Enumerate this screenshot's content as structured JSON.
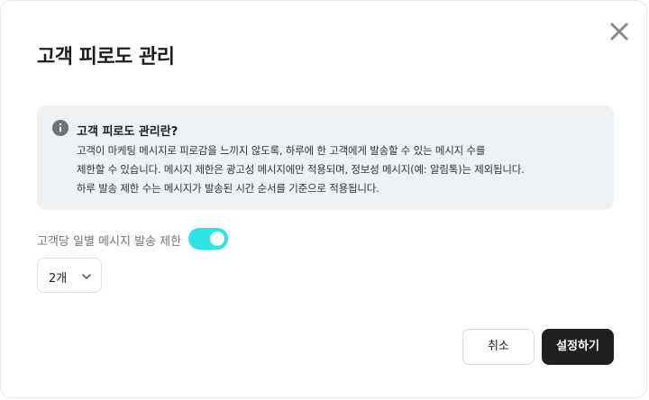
{
  "modal": {
    "title": "고객 피로도 관리",
    "close_icon": "close-icon"
  },
  "info": {
    "icon": "info-icon",
    "title": "고객 피로도 관리란?",
    "lines": [
      "고객이 마케팅 메시지로 피로감을 느끼지 않도록, 하루에 한 고객에게 발송할 수 있는 메시지 수를",
      "제한할 수 있습니다. 메시지 제한은 광고성 메시지에만 적용되며, 정보성 메시지(예: 알림톡)는 제외됩니다.",
      "하루 발송 제한 수는 메시지가 발송된 시간 순서를 기준으로 적용됩니다."
    ]
  },
  "limit": {
    "label": "고객당 일별 메시지 발송 제한",
    "toggle_on": true,
    "toggle_color": "#2ee3e3",
    "select_value": "2개",
    "select_icon": "chevron-down-icon"
  },
  "footer": {
    "cancel_label": "취소",
    "save_label": "설정하기"
  }
}
